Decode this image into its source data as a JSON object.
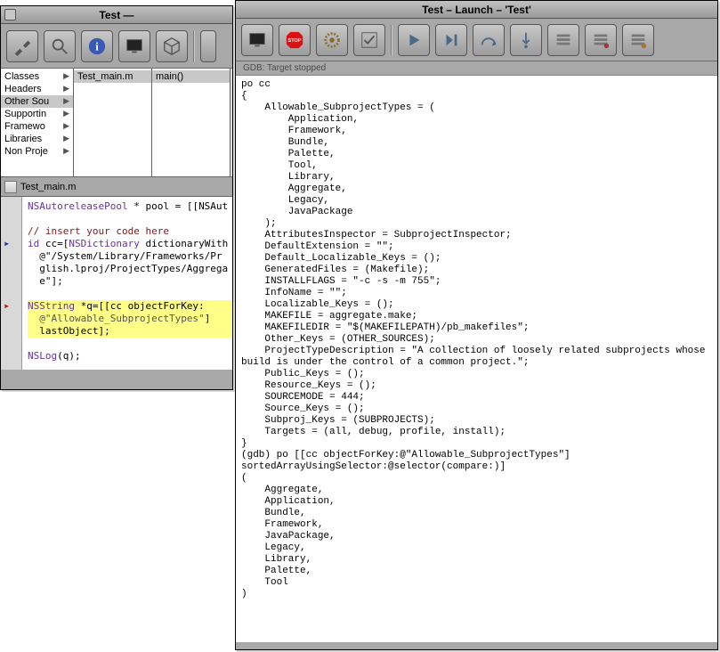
{
  "back_window": {
    "title": "Test —",
    "toolbar_icons": [
      "hammer-icon",
      "magnify-icon",
      "info-icon",
      "monitor-icon",
      "package-icon",
      "panel-icon"
    ],
    "browser": {
      "col1": [
        {
          "label": "Classes",
          "arrow": true
        },
        {
          "label": "Headers",
          "arrow": true
        },
        {
          "label": "Other Sou",
          "arrow": true,
          "sel": true
        },
        {
          "label": "Supportin",
          "arrow": true
        },
        {
          "label": "Framewo",
          "arrow": true
        },
        {
          "label": "Libraries",
          "arrow": true
        },
        {
          "label": "Non Proje",
          "arrow": true
        }
      ],
      "col2": [
        {
          "label": "Test_main.m",
          "sel": true
        }
      ],
      "col3": [
        {
          "label": "main()",
          "sel": true
        }
      ]
    },
    "pathbar_label": "Test_main.m",
    "code_lines": [
      "NSAutoreleasePool * pool = [[NSAut",
      "",
      "// insert your code here",
      "id cc=[NSDictionary dictionaryWith",
      "  @\"/System/Library/Frameworks/Pr",
      "  glish.lproj/ProjectTypes/Aggrega",
      "  e\"];",
      "",
      "NSString *q=[[cc objectForKey:",
      "  @\"Allowable_SubprojectTypes\"]",
      "  lastObject];",
      "",
      "NSLog(q);"
    ],
    "markers": {
      "blue_line_index": 3,
      "red_line_index": 8
    },
    "highlight_start": 8,
    "highlight_end": 10
  },
  "front_window": {
    "title": "Test – Launch – 'Test'",
    "toolbar_icons": [
      "monitor-icon",
      "stop-icon",
      "gear-icon",
      "check-icon",
      "play-icon",
      "step-over-icon",
      "step-arc-icon",
      "step-into-icon",
      "list1-icon",
      "list2-icon",
      "list3-icon"
    ],
    "status": "GDB: Target stopped",
    "console_text": "po cc\n{\n    Allowable_SubprojectTypes = (\n        Application,\n        Framework,\n        Bundle,\n        Palette,\n        Tool,\n        Library,\n        Aggregate,\n        Legacy,\n        JavaPackage\n    );\n    AttributesInspector = SubprojectInspector;\n    DefaultExtension = \"\";\n    Default_Localizable_Keys = ();\n    GeneratedFiles = (Makefile);\n    INSTALLFLAGS = \"-c -s -m 755\";\n    InfoName = \"\";\n    Localizable_Keys = ();\n    MAKEFILE = aggregate.make;\n    MAKEFILEDIR = \"$(MAKEFILEPATH)/pb_makefiles\";\n    Other_Keys = (OTHER_SOURCES);\n    ProjectTypeDescription = \"A collection of loosely related subprojects whose\nbuild is under the control of a common project.\";\n    Public_Keys = ();\n    Resource_Keys = ();\n    SOURCEMODE = 444;\n    Source_Keys = ();\n    Subproj_Keys = (SUBPROJECTS);\n    Targets = (all, debug, profile, install);\n}\n(gdb) po [[cc objectForKey:@\"Allowable_SubprojectTypes\"]\nsortedArrayUsingSelector:@selector(compare:)]\n(\n    Aggregate,\n    Application,\n    Bundle,\n    Framework,\n    JavaPackage,\n    Legacy,\n    Library,\n    Palette,\n    Tool\n)"
  }
}
